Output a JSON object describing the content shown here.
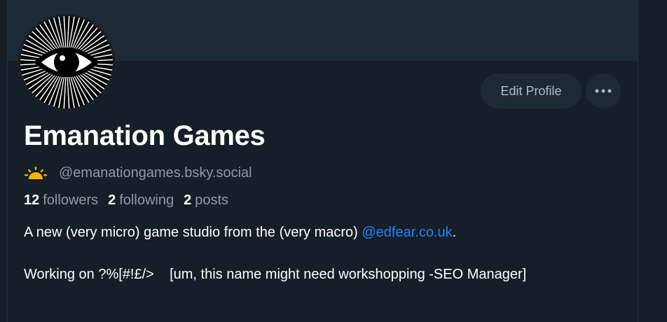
{
  "profile": {
    "display_name": "Emanation Games",
    "handle": "@emanationgames.bsky.social",
    "handle_icon": "sunrise-icon",
    "avatar_icon": "radiating-eye-icon"
  },
  "actions": {
    "edit_label": "Edit Profile",
    "more_icon": "more-horizontal-icon"
  },
  "stats": {
    "followers_count": "12",
    "followers_label": "followers",
    "following_count": "2",
    "following_label": "following",
    "posts_count": "2",
    "posts_label": "posts"
  },
  "bio": {
    "line1_prefix": "A new (very micro) game studio from the (very macro) ",
    "line1_link": "@edfear.co.uk",
    "line1_suffix": ".",
    "line2": "Working on ?%[#!£/>    [um, this name might need workshopping -SEO Manager]"
  },
  "colors": {
    "background": "#161e27",
    "banner": "#1e2936",
    "link": "#1d84ff",
    "muted": "#8d9bab",
    "accent_icon": "#f5b400"
  }
}
